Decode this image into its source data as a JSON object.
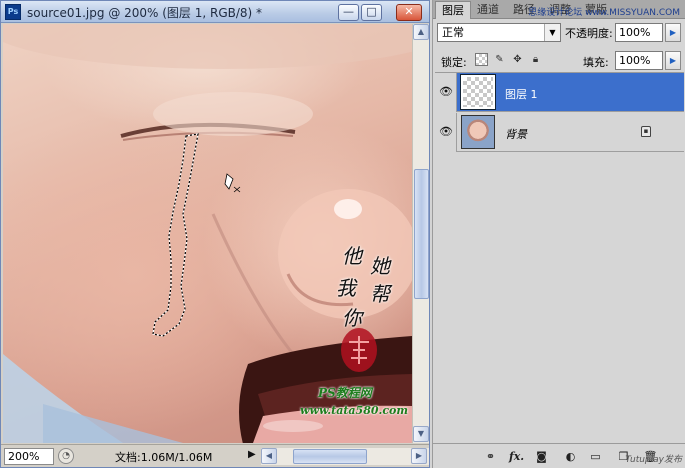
{
  "document_window": {
    "app_icon_text": "Ps",
    "title": "source01.jpg @ 200% (图层 1, RGB/8) *",
    "min_glyph": "—",
    "max_glyph": "□",
    "close_glyph": "✕"
  },
  "canvas": {
    "overlay_text": [
      "他",
      "她",
      "我",
      "帮",
      "你"
    ],
    "website_title": "PS教程网",
    "website_url": "www.tata580.com"
  },
  "status_bar": {
    "zoom": "200%",
    "doc_info": "文档:1.06M/1.06M",
    "arrow_glyph": "▶"
  },
  "layers_panel": {
    "tabs": [
      {
        "label": "图层",
        "active": true
      },
      {
        "label": "通道",
        "active": false
      },
      {
        "label": "路径",
        "active": false
      },
      {
        "label": "调整",
        "active": false
      },
      {
        "label": "蒙版",
        "active": false
      }
    ],
    "top_watermark": "思缘设计论坛 www.MISSYUAN.COM",
    "blend_mode": "正常",
    "opacity_label": "不透明度:",
    "opacity_value": "100%",
    "lock_label": "锁定:",
    "fill_label": "填充:",
    "fill_value": "100%",
    "layers": [
      {
        "name": "图层 1",
        "selected": true,
        "visible": true,
        "locked": false
      },
      {
        "name": "背景",
        "selected": false,
        "visible": true,
        "locked": true
      }
    ],
    "bottom_icons": [
      "link-icon",
      "fx-icon",
      "mask-icon",
      "adjustment-icon",
      "group-icon",
      "new-layer-icon",
      "trash-icon"
    ],
    "fx_text": "fx.",
    "bottom_watermark": "Tutuplay发布"
  },
  "colors": {
    "selected_layer": "#3c6fcc",
    "titlebar": "#b9cbe6",
    "stamp_red": "#b01020"
  }
}
